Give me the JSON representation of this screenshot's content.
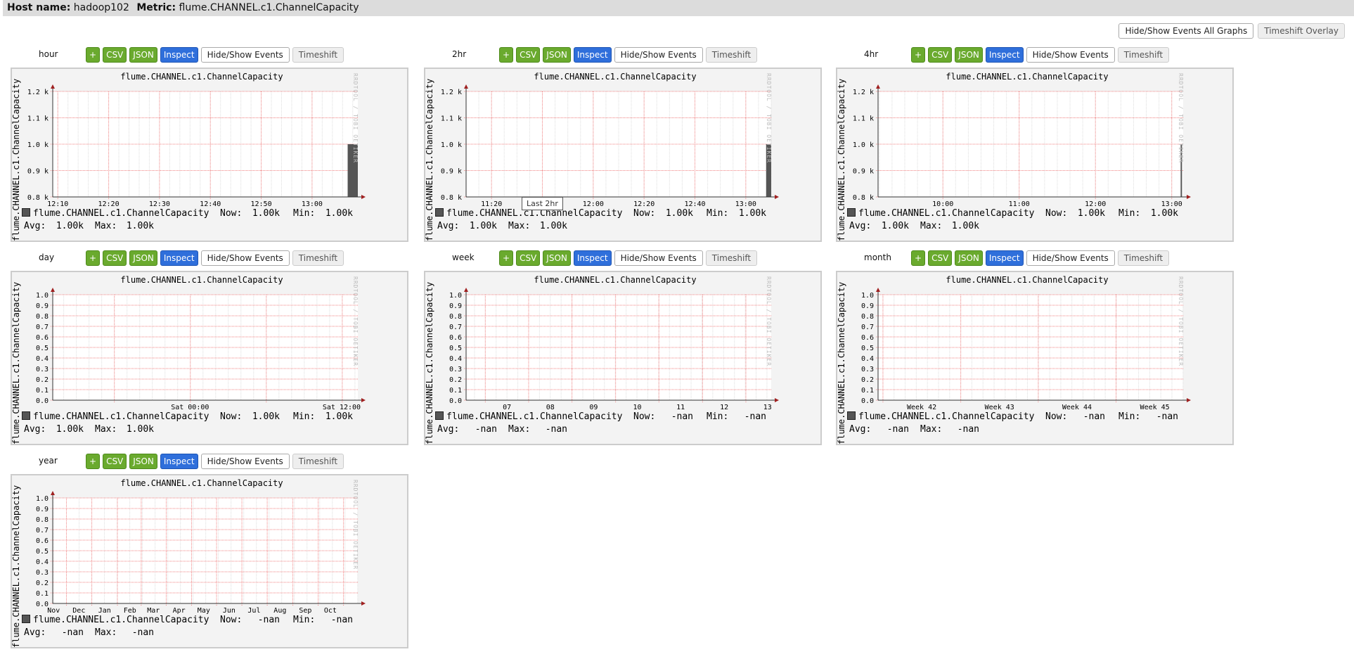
{
  "header": {
    "host_label": "Host name:",
    "host": "hadoop102",
    "metric_label": "Metric:",
    "metric": "flume.CHANNEL.c1.ChannelCapacity"
  },
  "top_buttons": {
    "hide_show_all": "Hide/Show Events All Graphs",
    "timeshift_overlay": "Timeshift Overlay"
  },
  "graph_buttons": {
    "plus": "+",
    "csv": "CSV",
    "json": "JSON",
    "inspect": "Inspect",
    "hide_show": "Hide/Show Events",
    "timeshift": "Timeshift"
  },
  "colors": {
    "area": "#555555",
    "grid_major": "#f08080",
    "grid_minor": "#cccccc",
    "panel_bg": "#f3f3f3",
    "csv_json": "#6aaa2e",
    "inspect": "#2f6fdb"
  },
  "watermark": "RRDTOOL / TOBI OETIKER",
  "tooltip": "Last 2hr",
  "chart_data": [
    {
      "period": "hour",
      "type": "area",
      "title": "flume.CHANNEL.c1.ChannelCapacity",
      "ylabel": "flume.CHANNEL.c1.ChannelCapacity",
      "y_ticks": [
        "1.2 k",
        "1.1 k",
        "1.0 k",
        "0.9 k",
        "0.8 k"
      ],
      "ylim": [
        800,
        1200
      ],
      "x_ticks": [
        "12:10",
        "12:20",
        "12:30",
        "12:40",
        "12:50",
        "13:00"
      ],
      "series": [
        {
          "name": "flume.CHANNEL.c1.ChannelCapacity",
          "points": [
            {
              "from": "13:07",
              "to": "13:09",
              "value": 1000
            }
          ]
        }
      ],
      "legend": {
        "now": "1.00k",
        "min": "1.00k",
        "avg": "1.00k",
        "max": "1.00k"
      }
    },
    {
      "period": "2hr",
      "type": "area",
      "title": "flume.CHANNEL.c1.ChannelCapacity",
      "ylabel": "flume.CHANNEL.c1.ChannelCapacity",
      "y_ticks": [
        "1.2 k",
        "1.1 k",
        "1.0 k",
        "0.9 k",
        "0.8 k"
      ],
      "ylim": [
        800,
        1200
      ],
      "x_ticks": [
        "11:20",
        "11:40",
        "12:00",
        "12:20",
        "12:40",
        "13:00"
      ],
      "series": [
        {
          "name": "flume.CHANNEL.c1.ChannelCapacity",
          "points": [
            {
              "from": "13:08",
              "to": "13:10",
              "value": 1000
            }
          ]
        }
      ],
      "legend": {
        "now": "1.00k",
        "min": "1.00k",
        "avg": "1.00k",
        "max": "1.00k"
      }
    },
    {
      "period": "4hr",
      "type": "area",
      "title": "flume.CHANNEL.c1.ChannelCapacity",
      "ylabel": "flume.CHANNEL.c1.ChannelCapacity",
      "y_ticks": [
        "1.2 k",
        "1.1 k",
        "1.0 k",
        "0.9 k",
        "0.8 k"
      ],
      "ylim": [
        800,
        1200
      ],
      "x_ticks": [
        "10:00",
        "11:00",
        "12:00",
        "13:00"
      ],
      "series": [
        {
          "name": "flume.CHANNEL.c1.ChannelCapacity",
          "points": [
            {
              "from": "13:07",
              "to": "13:08",
              "value": 1000
            }
          ]
        }
      ],
      "legend": {
        "now": "1.00k",
        "min": "1.00k",
        "avg": "1.00k",
        "max": "1.00k"
      }
    },
    {
      "period": "day",
      "type": "area",
      "title": "flume.CHANNEL.c1.ChannelCapacity",
      "ylabel": "flume.CHANNEL.c1.ChannelCapacity",
      "y_ticks": [
        "1.0",
        "0.9",
        "0.8",
        "0.7",
        "0.6",
        "0.5",
        "0.4",
        "0.3",
        "0.2",
        "0.1",
        "0.0"
      ],
      "ylim": [
        0,
        1
      ],
      "x_ticks": [
        "Sat 00:00",
        "Sat 12:00"
      ],
      "series": [
        {
          "name": "flume.CHANNEL.c1.ChannelCapacity",
          "points": []
        }
      ],
      "legend": {
        "now": "1.00k",
        "min": "1.00k",
        "avg": "1.00k",
        "max": "1.00k"
      }
    },
    {
      "period": "week",
      "type": "area",
      "title": "flume.CHANNEL.c1.ChannelCapacity",
      "ylabel": "flume.CHANNEL.c1.ChannelCapacity",
      "y_ticks": [
        "1.0",
        "0.9",
        "0.8",
        "0.7",
        "0.6",
        "0.5",
        "0.4",
        "0.3",
        "0.2",
        "0.1",
        "0.0"
      ],
      "ylim": [
        0,
        1
      ],
      "x_ticks": [
        "07",
        "08",
        "09",
        "10",
        "11",
        "12",
        "13"
      ],
      "series": [
        {
          "name": "flume.CHANNEL.c1.ChannelCapacity",
          "points": []
        }
      ],
      "legend": {
        "now": "-nan",
        "min": "-nan",
        "avg": "-nan",
        "max": "-nan"
      }
    },
    {
      "period": "month",
      "type": "area",
      "title": "flume.CHANNEL.c1.ChannelCapacity",
      "ylabel": "flume.CHANNEL.c1.ChannelCapacity",
      "y_ticks": [
        "1.0",
        "0.9",
        "0.8",
        "0.7",
        "0.6",
        "0.5",
        "0.4",
        "0.3",
        "0.2",
        "0.1",
        "0.0"
      ],
      "ylim": [
        0,
        1
      ],
      "x_ticks": [
        "Week 42",
        "Week 43",
        "Week 44",
        "Week 45"
      ],
      "series": [
        {
          "name": "flume.CHANNEL.c1.ChannelCapacity",
          "points": []
        }
      ],
      "legend": {
        "now": "-nan",
        "min": "-nan",
        "avg": "-nan",
        "max": "-nan"
      }
    },
    {
      "period": "year",
      "type": "area",
      "title": "flume.CHANNEL.c1.ChannelCapacity",
      "ylabel": "flume.CHANNEL.c1.ChannelCapacity",
      "y_ticks": [
        "1.0",
        "0.9",
        "0.8",
        "0.7",
        "0.6",
        "0.5",
        "0.4",
        "0.3",
        "0.2",
        "0.1",
        "0.0"
      ],
      "ylim": [
        0,
        1
      ],
      "x_ticks": [
        "Nov",
        "Dec",
        "Jan",
        "Feb",
        "Mar",
        "Apr",
        "May",
        "Jun",
        "Jul",
        "Aug",
        "Sep",
        "Oct"
      ],
      "series": [
        {
          "name": "flume.CHANNEL.c1.ChannelCapacity",
          "points": []
        }
      ],
      "legend": {
        "now": "-nan",
        "min": "-nan",
        "avg": "-nan",
        "max": "-nan"
      }
    }
  ],
  "legend_labels": {
    "now": "Now:",
    "min": "Min:",
    "avg": "Avg:",
    "max": "Max:"
  }
}
